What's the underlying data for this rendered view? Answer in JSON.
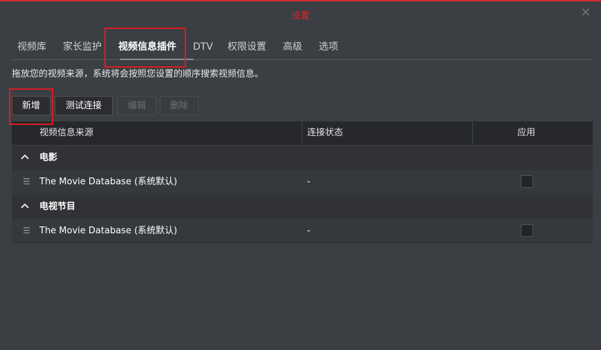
{
  "window": {
    "title": "设置"
  },
  "tabs": [
    {
      "label": "视频库"
    },
    {
      "label": "家长监护"
    },
    {
      "label": "视频信息插件",
      "active": true
    },
    {
      "label": "DTV"
    },
    {
      "label": "权限设置"
    },
    {
      "label": "高级"
    },
    {
      "label": "选项"
    }
  ],
  "hint": "拖放您的视频来源，系统将会按照您设置的顺序搜索视频信息。",
  "toolbar": {
    "add": "新增",
    "test": "测试连接",
    "edit": "编辑",
    "delete": "删除"
  },
  "table": {
    "headers": {
      "source": "视频信息来源",
      "status": "连接状态",
      "apply": "应用"
    },
    "groups": [
      {
        "label": "电影",
        "rows": [
          {
            "name": "The Movie Database (系统默认)",
            "status": "-",
            "applied": false
          }
        ]
      },
      {
        "label": "电视节目",
        "rows": [
          {
            "name": "The Movie Database (系统默认)",
            "status": "-",
            "applied": false
          }
        ]
      }
    ]
  },
  "colors": {
    "accent": "#d8282e",
    "highlight_box": "#e01b22",
    "background": "#3b3e42"
  }
}
